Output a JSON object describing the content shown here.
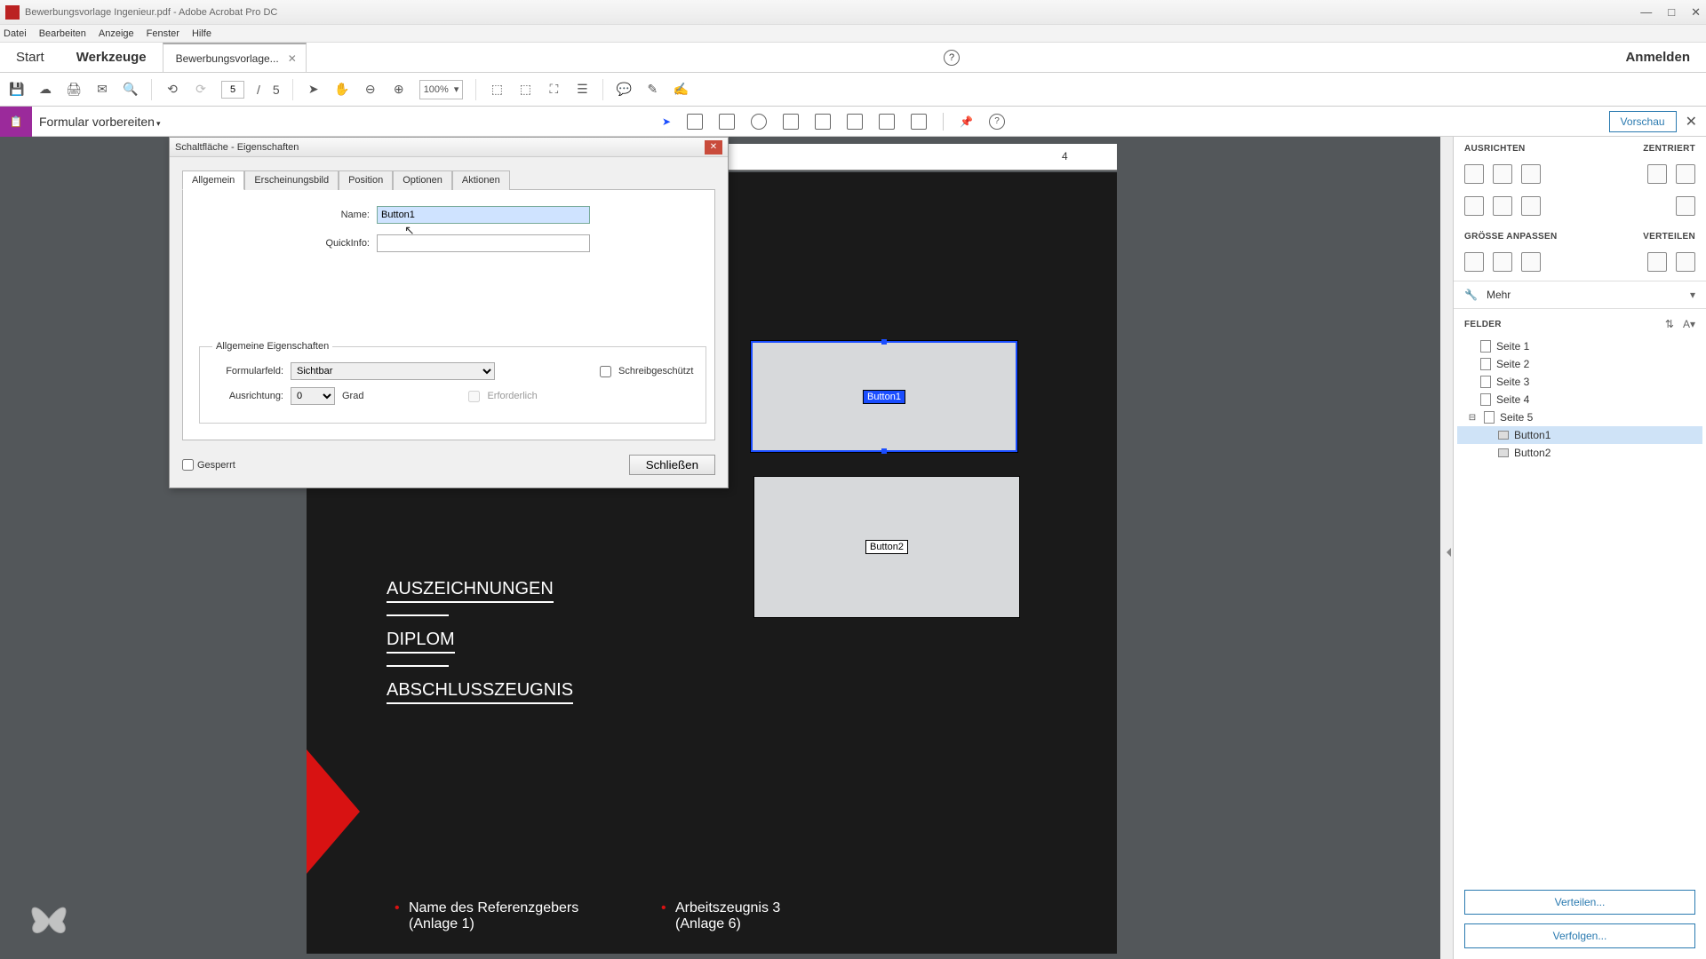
{
  "titlebar": {
    "title": "Bewerbungsvorlage Ingenieur.pdf - Adobe Acrobat Pro DC"
  },
  "menu": {
    "items": [
      "Datei",
      "Bearbeiten",
      "Anzeige",
      "Fenster",
      "Hilfe"
    ]
  },
  "tabs": {
    "start": "Start",
    "tools": "Werkzeuge",
    "doc": "Bewerbungsvorlage...",
    "login": "Anmelden"
  },
  "toolbar": {
    "page_current": "5",
    "page_sep": "/",
    "page_total": "5",
    "zoom": "100%"
  },
  "subbar": {
    "tool": "Formular vorbereiten",
    "preview": "Vorschau"
  },
  "dialog": {
    "title": "Schaltfläche - Eigenschaften",
    "tabs": [
      "Allgemein",
      "Erscheinungsbild",
      "Position",
      "Optionen",
      "Aktionen"
    ],
    "name_label": "Name:",
    "name_value": "Button1",
    "quick_label": "QuickInfo:",
    "quick_value": "",
    "fieldset_legend": "Allgemeine Eigenschaften",
    "formfield_label": "Formularfeld:",
    "formfield_value": "Sichtbar",
    "orient_label": "Ausrichtung:",
    "orient_value": "0",
    "orient_suffix": "Grad",
    "readonly": "Schreibgeschützt",
    "required": "Erforderlich",
    "locked": "Gesperrt",
    "close": "Schließen"
  },
  "document": {
    "page_number": "4",
    "h1": "AUSZEICHNUNGEN",
    "h2": "DIPLOM",
    "h3": "ABSCHLUSSZEUGNIS",
    "field1": "Button1",
    "field2": "Button2",
    "ref1a": "Name des Referenzgebers",
    "ref1b": "(Anlage 1)",
    "ref2a": "Arbeitszeugnis 3",
    "ref2b": "(Anlage 6)"
  },
  "rightpanel": {
    "sec_align": "AUSRICHTEN",
    "sec_center": "ZENTRIERT",
    "sec_size": "GRÖSSE ANPASSEN",
    "sec_dist": "VERTEILEN",
    "more": "Mehr",
    "felder": "FELDER",
    "pages": [
      "Seite 1",
      "Seite 2",
      "Seite 3",
      "Seite 4",
      "Seite 5"
    ],
    "children": [
      "Button1",
      "Button2"
    ],
    "distribute": "Verteilen...",
    "track": "Verfolgen..."
  }
}
